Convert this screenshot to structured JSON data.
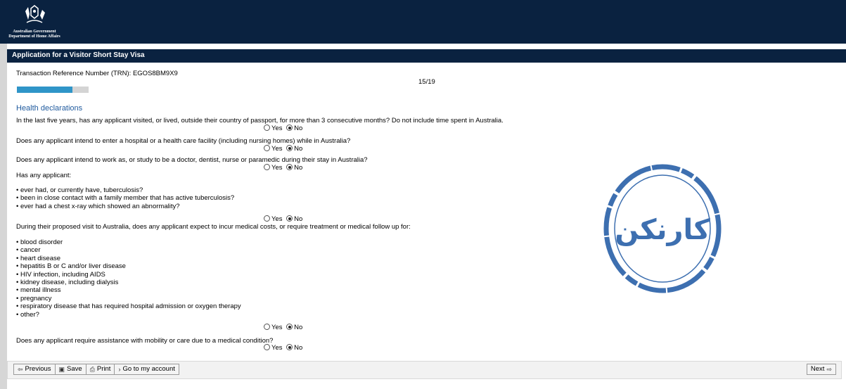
{
  "header": {
    "gov_line1": "Australian Government",
    "gov_line2": "Department of Home Affairs",
    "app_title": "Application for a Visitor Short Stay Visa"
  },
  "trn": "Transaction Reference Number (TRN): EGOS8BM9X9",
  "progress": {
    "page": "15/19",
    "fraction": 0.77,
    "fill_color": "#2f95c8"
  },
  "section_title": "Health declarations",
  "questions": [
    {
      "text": "In the last five years, has any applicant visited, or lived, outside their country of passport, for more than 3 consecutive months? Do not include time spent in Australia.",
      "yes": "Yes",
      "no": "No",
      "selected": "No"
    },
    {
      "text": "Does any applicant intend to enter a hospital or a health care facility (including nursing homes) while in Australia?",
      "yes": "Yes",
      "no": "No",
      "selected": "No"
    },
    {
      "text": "Does any applicant intend to work as, or study to be a doctor, dentist, nurse or paramedic during their stay in Australia?",
      "yes": "Yes",
      "no": "No",
      "selected": "No"
    },
    {
      "text": "Has any applicant:",
      "bullets": [
        "ever had, or currently have, tuberculosis?",
        "been in close contact with a family member that has active tuberculosis?",
        "ever had a chest x-ray which showed an abnormality?"
      ],
      "yes": "Yes",
      "no": "No",
      "selected": "No"
    },
    {
      "text": "During their proposed visit to Australia, does any applicant expect to incur medical costs, or require treatment or medical follow up for:",
      "bullets": [
        "blood disorder",
        "cancer",
        "heart disease",
        "hepatitis B or C and/or liver disease",
        "HIV infection, including AIDS",
        "kidney disease, including dialysis",
        "mental illness",
        "pregnancy",
        "respiratory disease that has required hospital admission or oxygen therapy",
        "other?"
      ],
      "yes": "Yes",
      "no": "No",
      "selected": "No"
    },
    {
      "text": "Does any applicant require assistance with mobility or care due to a medical condition?",
      "yes": "Yes",
      "no": "No",
      "selected": "No"
    }
  ],
  "footer": {
    "previous": "Previous",
    "save": "Save",
    "print": "Print",
    "account": "Go to my account",
    "next": "Next"
  },
  "watermark": {
    "text": "کارنکن",
    "color": "#3d6fb0"
  },
  "icons": [
    "crest-icon",
    "previous-icon",
    "save-icon",
    "print-icon",
    "account-arrow-icon",
    "next-icon"
  ]
}
